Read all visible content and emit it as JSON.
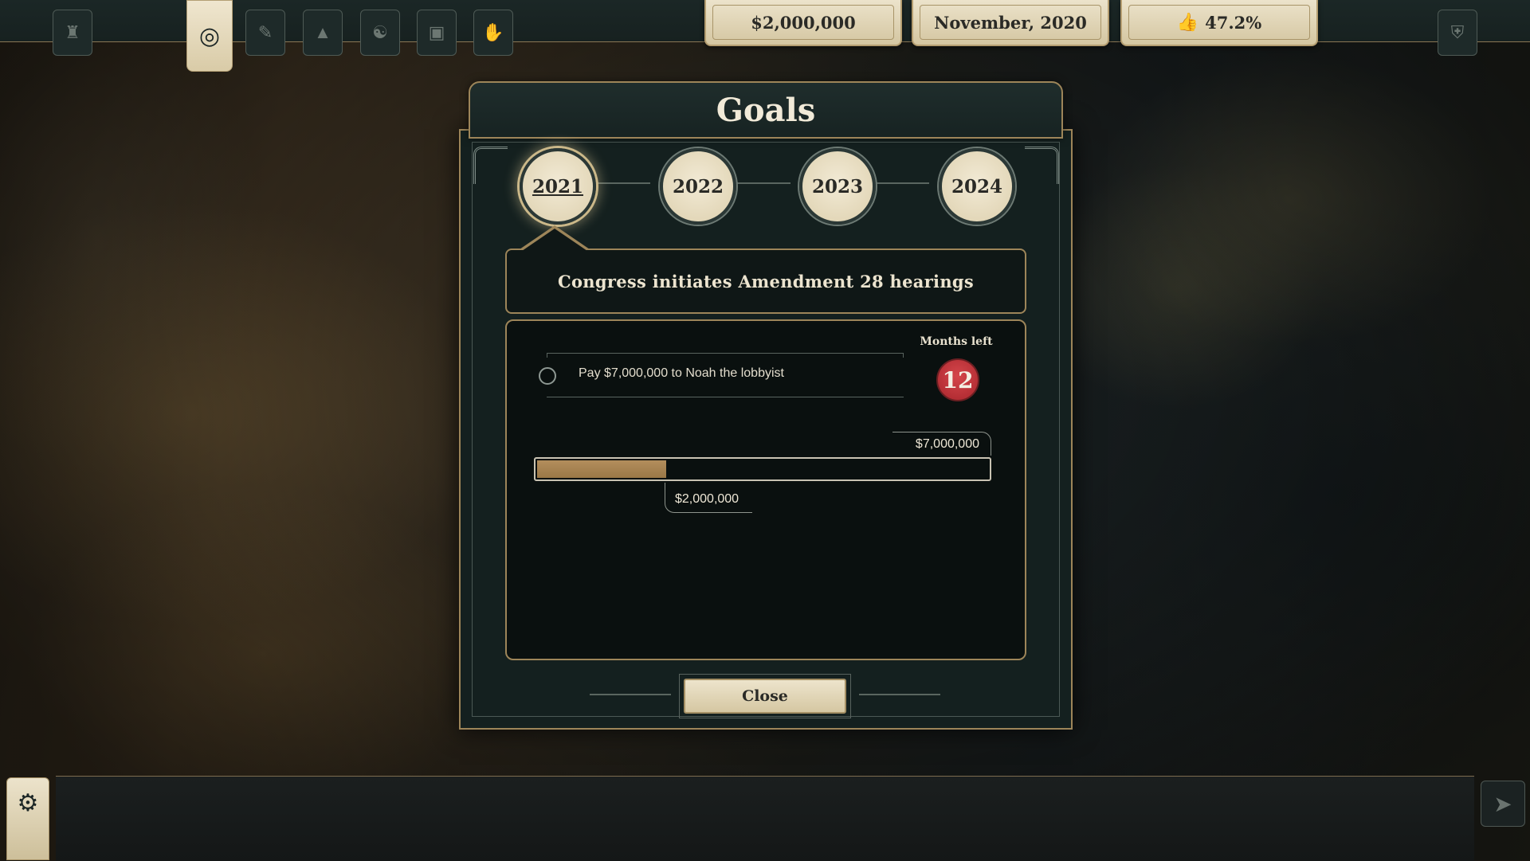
{
  "topbar": {
    "money": "$2,000,000",
    "date": "November, 2020",
    "approval": "47.2%",
    "icons": [
      "tower-icon",
      "goals-target-icon",
      "document-icon",
      "spread-icon",
      "globe-hand-icon",
      "briefcase-icon",
      "hand-gesture-icon"
    ],
    "right_icon": "shield-icon"
  },
  "modal": {
    "title": "Goals",
    "years": [
      "2021",
      "2022",
      "2023",
      "2024"
    ],
    "selected_year": "2021",
    "goal_title": "Congress initiates Amendment 28 hearings",
    "task": {
      "text": "Pay $7,000,000 to Noah the lobbyist",
      "completed": false
    },
    "months_left_label": "Months left",
    "months_left": "12",
    "progress": {
      "target_label": "$7,000,000",
      "current_label": "$2,000,000",
      "fraction": 0.2857
    },
    "close_label": "Close"
  },
  "bottombar": {
    "settings_icon": "gear-icon",
    "next_icon": "arrow-right-icon"
  },
  "colors": {
    "accent_gold": "#9d8559",
    "panel_dark": "#0a100f",
    "parchment": "#ece3cb",
    "badge_red": "#c0363d",
    "progress_fill": "#b38e5c"
  }
}
